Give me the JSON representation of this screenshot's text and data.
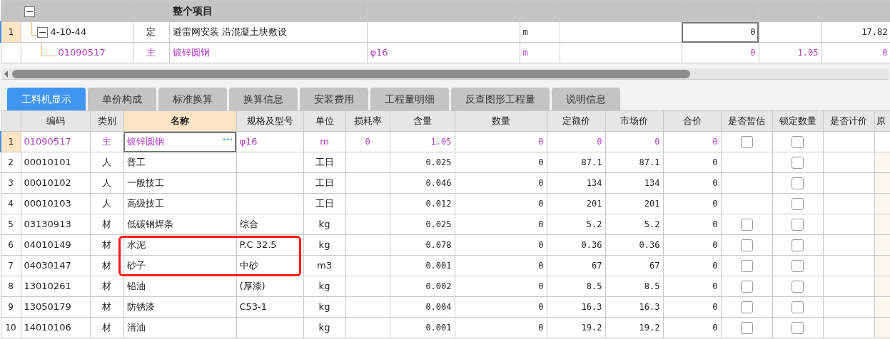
{
  "top_grid": {
    "group_row": {
      "title": "整个项目",
      "expanded": true
    },
    "rows": [
      {
        "row_number": "1",
        "selected": true,
        "expanded": true,
        "kind": "quota",
        "column_1": "4-10-44",
        "column_2": "定",
        "column_3": "避雷网安装 沿混凝土块敷设",
        "column_5": "m",
        "column_7": "0",
        "column_9": "17.82"
      },
      {
        "kind": "material",
        "column_1": "01090517",
        "column_2": "主",
        "column_3": "镀锌圆钢",
        "column_4": "φ16",
        "column_5": "m",
        "column_7": "0",
        "column_8": "1.05",
        "column_9": "0"
      }
    ]
  },
  "tabs": [
    {
      "label": "工料机显示",
      "selected": true
    },
    {
      "label": "单价构成",
      "selected": false
    },
    {
      "label": "标准换算",
      "selected": false
    },
    {
      "label": "换算信息",
      "selected": false
    },
    {
      "label": "安装费用",
      "selected": false
    },
    {
      "label": "工程量明细",
      "selected": false
    },
    {
      "label": "反查图形工程量",
      "selected": false
    },
    {
      "label": "说明信息",
      "selected": false
    }
  ],
  "table": {
    "columns": [
      {
        "label": "编码",
        "selected": false
      },
      {
        "label": "类别",
        "selected": false
      },
      {
        "label": "名称",
        "selected": true
      },
      {
        "label": "规格及型号",
        "selected": false
      },
      {
        "label": "单位",
        "selected": false
      },
      {
        "label": "损耗率",
        "selected": false
      },
      {
        "label": "含量",
        "selected": false
      },
      {
        "label": "数量",
        "selected": false
      },
      {
        "label": "定额价",
        "selected": false
      },
      {
        "label": "市场价",
        "selected": false
      },
      {
        "label": "合价",
        "selected": false
      },
      {
        "label": "是否暂估",
        "selected": false
      },
      {
        "label": "锁定数量",
        "selected": false
      },
      {
        "label": "是否计价",
        "selected": false
      },
      {
        "label": "原",
        "selected": false
      }
    ],
    "rows": [
      {
        "row_number": "1",
        "selected": true,
        "highlighted": false,
        "kind": "material",
        "code": "01090517",
        "type": "主",
        "name": "镀锌圆钢",
        "edit_button": "···",
        "spec": "φ16",
        "unit": "m",
        "loss_rate": "0",
        "content": "1.05",
        "quantity": "0",
        "quota_price": "0",
        "market_price": "0",
        "total": "0",
        "provisional": false,
        "locked": false
      },
      {
        "row_number": "2",
        "selected": false,
        "highlighted": false,
        "kind": "normal",
        "code": "00010101",
        "type": "人",
        "name": "普工",
        "unit": "工日",
        "content": "0.025",
        "quantity": "0",
        "quota_price": "87.1",
        "market_price": "87.1",
        "total": "0",
        "locked": false
      },
      {
        "row_number": "3",
        "selected": false,
        "highlighted": false,
        "kind": "normal",
        "code": "00010102",
        "type": "人",
        "name": "一般技工",
        "unit": "工日",
        "content": "0.046",
        "quantity": "0",
        "quota_price": "134",
        "market_price": "134",
        "total": "0",
        "locked": false
      },
      {
        "row_number": "4",
        "selected": false,
        "highlighted": false,
        "kind": "normal",
        "code": "00010103",
        "type": "人",
        "name": "高级技工",
        "unit": "工日",
        "content": "0.012",
        "quantity": "0",
        "quota_price": "201",
        "market_price": "201",
        "total": "0",
        "locked": false
      },
      {
        "row_number": "5",
        "selected": false,
        "highlighted": false,
        "kind": "normal",
        "code": "03130913",
        "type": "材",
        "name": "低碳钢焊条",
        "spec": "综合",
        "unit": "kg",
        "content": "0.025",
        "quantity": "0",
        "quota_price": "5.2",
        "market_price": "5.2",
        "total": "0",
        "provisional": false,
        "locked": false
      },
      {
        "row_number": "6",
        "selected": false,
        "highlighted": true,
        "kind": "normal",
        "code": "04010149",
        "type": "材",
        "name": "水泥",
        "spec": "P.C 32.5",
        "unit": "kg",
        "content": "0.078",
        "quantity": "0",
        "quota_price": "0.36",
        "market_price": "0.36",
        "total": "0",
        "provisional": false,
        "locked": false
      },
      {
        "row_number": "7",
        "selected": false,
        "highlighted": true,
        "kind": "normal",
        "code": "04030147",
        "type": "材",
        "name": "砂子",
        "spec": "中砂",
        "unit": "m3",
        "content": "0.001",
        "quantity": "0",
        "quota_price": "67",
        "market_price": "67",
        "total": "0",
        "provisional": false,
        "locked": false
      },
      {
        "row_number": "8",
        "selected": false,
        "highlighted": false,
        "kind": "normal",
        "code": "13010261",
        "type": "材",
        "name": "铅油",
        "spec": "(厚漆)",
        "unit": "kg",
        "content": "0.002",
        "quantity": "0",
        "quota_price": "8.5",
        "market_price": "8.5",
        "total": "0",
        "provisional": false,
        "locked": false
      },
      {
        "row_number": "9",
        "selected": false,
        "highlighted": false,
        "kind": "normal",
        "code": "13050179",
        "type": "材",
        "name": "防锈漆",
        "spec": "C53-1",
        "unit": "kg",
        "content": "0.004",
        "quantity": "0",
        "quota_price": "16.3",
        "market_price": "16.3",
        "total": "0",
        "provisional": false,
        "locked": false
      },
      {
        "row_number": "10",
        "selected": false,
        "highlighted": false,
        "kind": "normal",
        "code": "14010106",
        "type": "材",
        "name": "清油",
        "unit": "kg",
        "content": "0.001",
        "quantity": "0",
        "quota_price": "19.2",
        "market_price": "19.2",
        "total": "0",
        "provisional": false,
        "locked": false
      }
    ]
  }
}
